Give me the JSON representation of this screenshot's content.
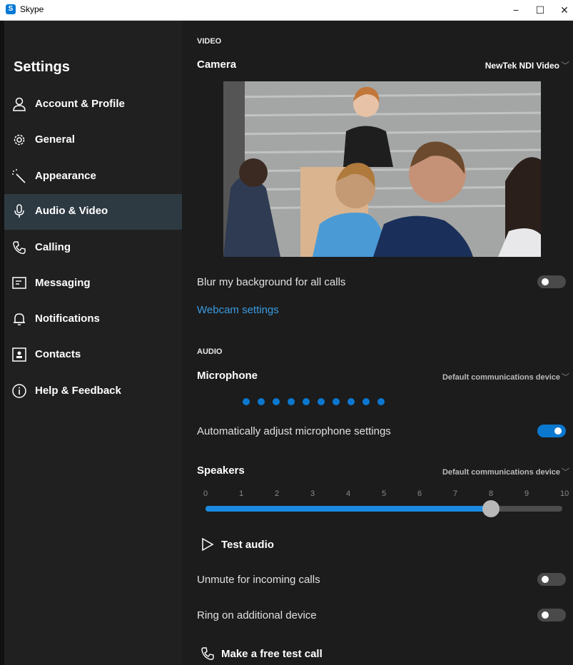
{
  "window": {
    "title": "Skype",
    "controls": [
      "−",
      "☐",
      "✕"
    ]
  },
  "sidebar": {
    "title": "Settings",
    "items": [
      {
        "label": "Account & Profile",
        "icon": "person-icon",
        "active": false
      },
      {
        "label": "General",
        "icon": "gear-icon",
        "active": false
      },
      {
        "label": "Appearance",
        "icon": "magic-wand-icon",
        "active": false
      },
      {
        "label": "Audio & Video",
        "icon": "microphone-icon",
        "active": true
      },
      {
        "label": "Calling",
        "icon": "phone-icon",
        "active": false
      },
      {
        "label": "Messaging",
        "icon": "message-icon",
        "active": false
      },
      {
        "label": "Notifications",
        "icon": "bell-icon",
        "active": false
      },
      {
        "label": "Contacts",
        "icon": "contact-card-icon",
        "active": false
      },
      {
        "label": "Help & Feedback",
        "icon": "info-icon",
        "active": false
      }
    ]
  },
  "video": {
    "section": "VIDEO",
    "camera_label": "Camera",
    "camera_device": "NewTek NDI Video",
    "blur_label": "Blur my background for all calls",
    "blur_on": false,
    "webcam_link": "Webcam settings"
  },
  "audio": {
    "section": "AUDIO",
    "mic_label": "Microphone",
    "mic_device": "Default communications device",
    "mic_level_dots": 10,
    "auto_adjust_label": "Automatically adjust microphone settings",
    "auto_adjust_on": true,
    "speakers_label": "Speakers",
    "speakers_device": "Default communications device",
    "volume_ticks": [
      "0",
      "1",
      "2",
      "3",
      "4",
      "5",
      "6",
      "7",
      "8",
      "9",
      "10"
    ],
    "volume_value": 8,
    "test_audio": "Test audio",
    "unmute_label": "Unmute for incoming calls",
    "unmute_on": false,
    "ring_label": "Ring on additional device",
    "ring_on": false,
    "test_call": "Make a free test call"
  },
  "colors": {
    "accent": "#0b78d0",
    "link": "#3a9be0",
    "sidebar_bg": "#202020",
    "main_bg": "#1c1c1c",
    "active_bg": "#2e3a42"
  }
}
